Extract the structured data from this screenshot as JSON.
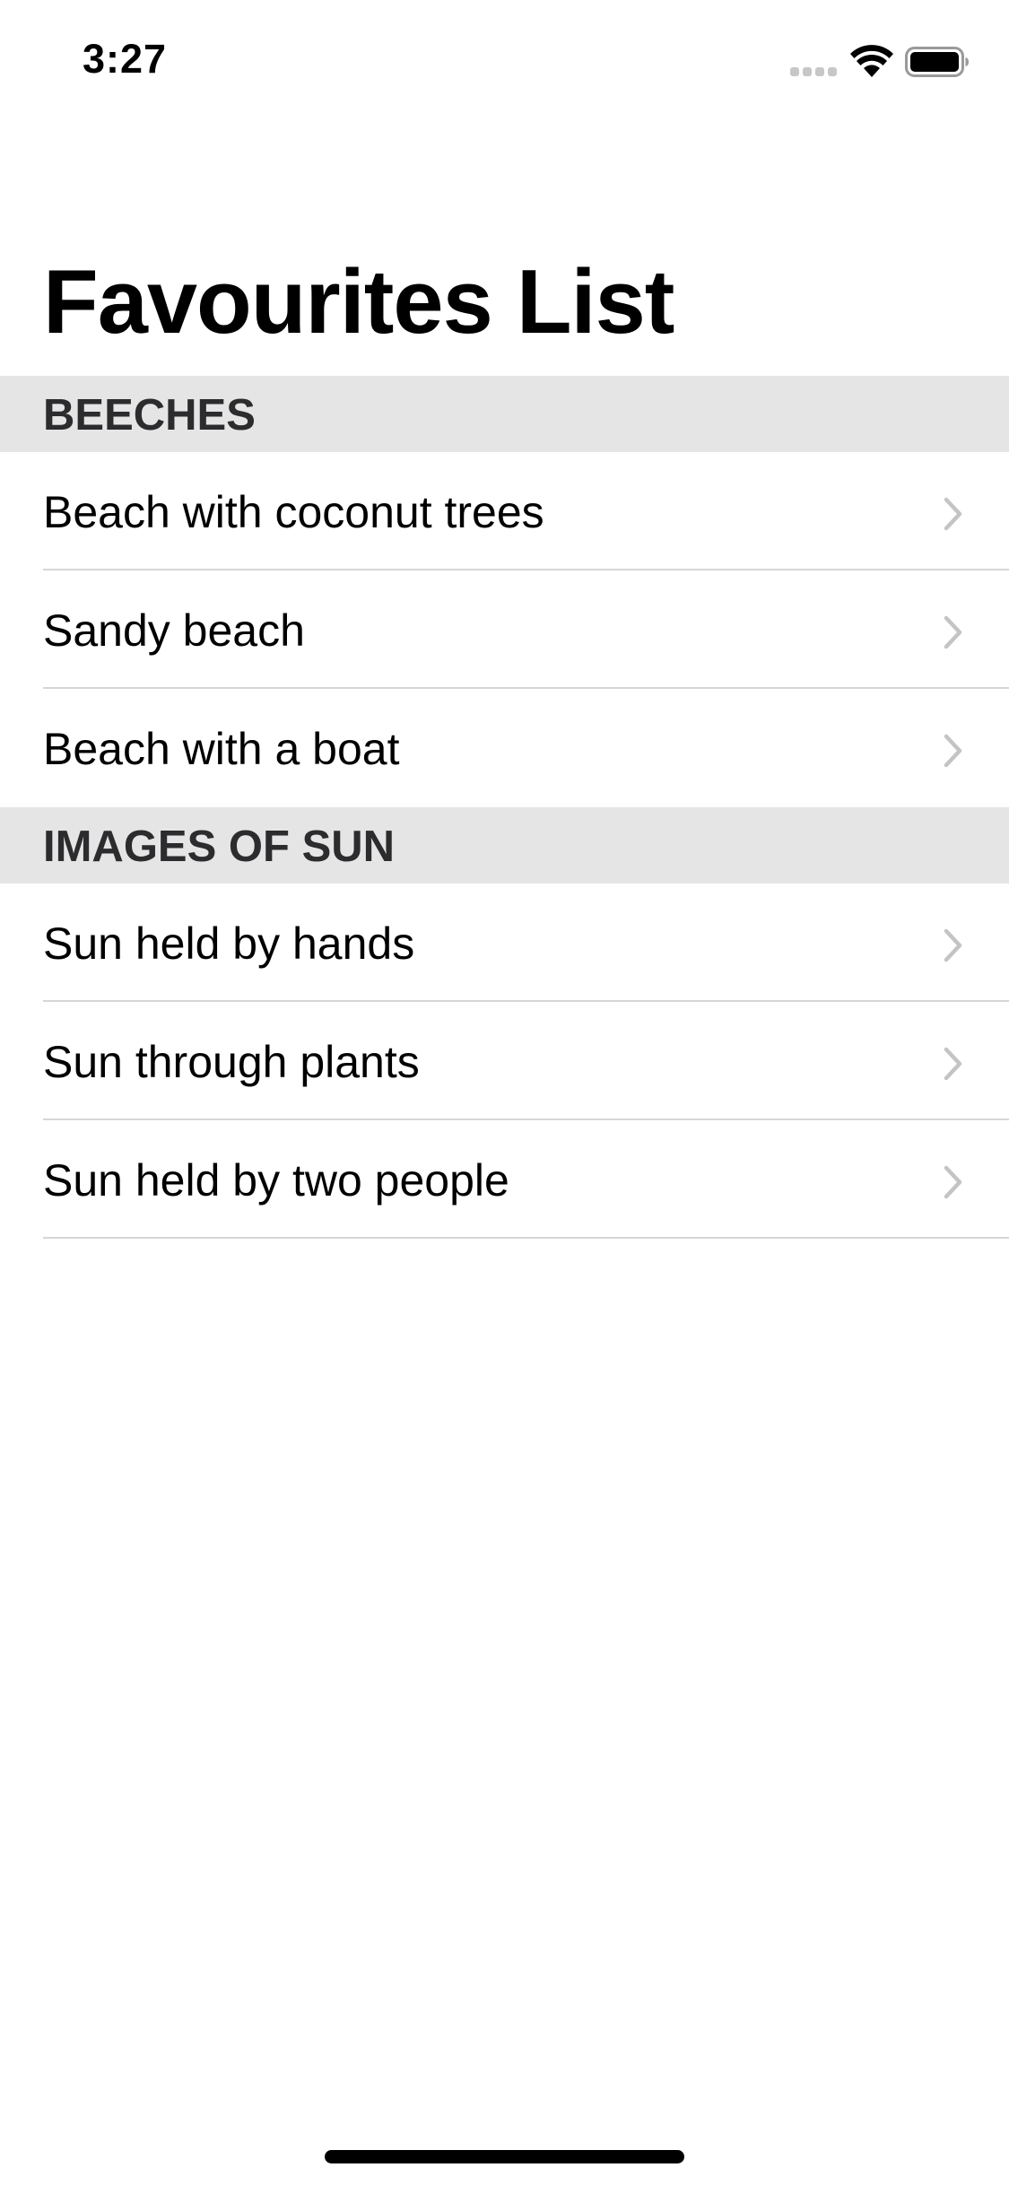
{
  "status_bar": {
    "time": "3:27",
    "icons": [
      "signal-icon",
      "wifi-icon",
      "battery-icon"
    ]
  },
  "page": {
    "title": "Favourites List"
  },
  "sections": [
    {
      "header": "BEECHES",
      "items": [
        {
          "label": "Beach with coconut trees",
          "icon": "chevron-right-icon"
        },
        {
          "label": "Sandy beach",
          "icon": "chevron-right-icon"
        },
        {
          "label": "Beach with a boat",
          "icon": "chevron-right-icon"
        }
      ]
    },
    {
      "header": "IMAGES OF SUN",
      "items": [
        {
          "label": "Sun held by hands",
          "icon": "chevron-right-icon"
        },
        {
          "label": "Sun through plants",
          "icon": "chevron-right-icon"
        },
        {
          "label": "Sun held by two people",
          "icon": "chevron-right-icon"
        }
      ]
    }
  ],
  "colors": {
    "section_header_background": "#e5e5e5",
    "section_header_text": "#2c2c2e",
    "chevron": "#c4c4c7",
    "divider": "#d6d6d8"
  }
}
